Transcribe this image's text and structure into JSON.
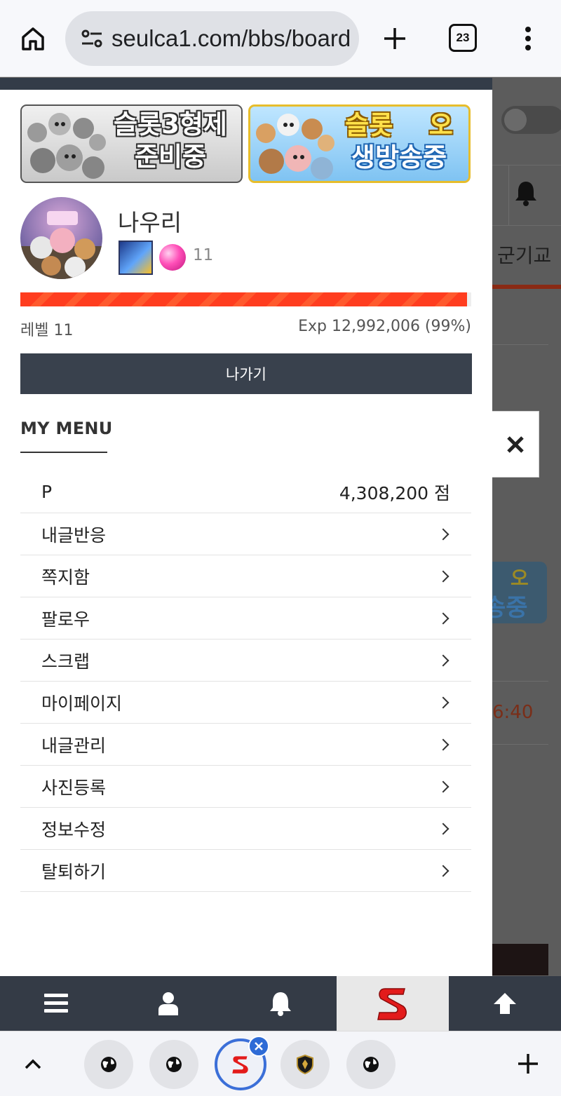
{
  "browser": {
    "url": "seulca1.com/bbs/board",
    "tab_count": "23"
  },
  "background_page": {
    "nav_text": "군기교",
    "time_text": "6:40",
    "banner_fragment_top": "오",
    "banner_fragment_bottom": "송중"
  },
  "banners": [
    {
      "line1": "슬롯3형제",
      "line2": "준비중"
    },
    {
      "line1_a": "슬롯",
      "line1_b": "오",
      "line2": "생방송중"
    }
  ],
  "profile": {
    "username": "나우리",
    "level_number": "11",
    "exp_percent": 99,
    "level_label": "레벨 11",
    "exp_label": "Exp 12,992,006 (99%)"
  },
  "logout_label": "나가기",
  "my_menu": {
    "title": "MY MENU",
    "points_label": "P",
    "points_value": "4,308,200 점",
    "items": [
      {
        "label": "내글반응"
      },
      {
        "label": "쪽지함"
      },
      {
        "label": "팔로우"
      },
      {
        "label": "스크랩"
      },
      {
        "label": "마이페이지"
      },
      {
        "label": "내글관리"
      },
      {
        "label": "사진등록"
      },
      {
        "label": "정보수정"
      },
      {
        "label": "탈퇴하기"
      }
    ]
  },
  "site_nav": {
    "items": [
      "menu-icon",
      "user-icon",
      "bell-icon",
      "site-logo-icon",
      "arrow-up-icon"
    ],
    "active_index": 3
  },
  "bottom_tabs": {
    "icons": [
      "globe-icon",
      "globe-icon",
      "site-logo-icon",
      "shield-icon",
      "globe-icon"
    ],
    "active_index": 2
  },
  "colors": {
    "accent_red": "#ff3d1f",
    "dark_panel": "#39414d",
    "browser_blue": "#3b6fd8"
  }
}
